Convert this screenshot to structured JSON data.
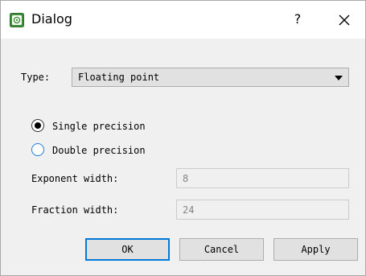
{
  "window": {
    "title": "Dialog",
    "help_label": "?",
    "icon": "app-icon",
    "close_icon": "close-icon"
  },
  "type_row": {
    "label": "Type:",
    "value": "Floating point"
  },
  "precision": {
    "single_label": "Single precision",
    "double_label": "Double precision",
    "selected": "single"
  },
  "exponent": {
    "label": "Exponent width:",
    "value": "8"
  },
  "fraction": {
    "label": "Fraction width:",
    "value": "24"
  },
  "buttons": {
    "ok": "OK",
    "cancel": "Cancel",
    "apply": "Apply"
  },
  "colors": {
    "focus_accent": "#0078d7",
    "radio_unchecked_border": "#1e7de0",
    "disabled_text": "#838383"
  }
}
